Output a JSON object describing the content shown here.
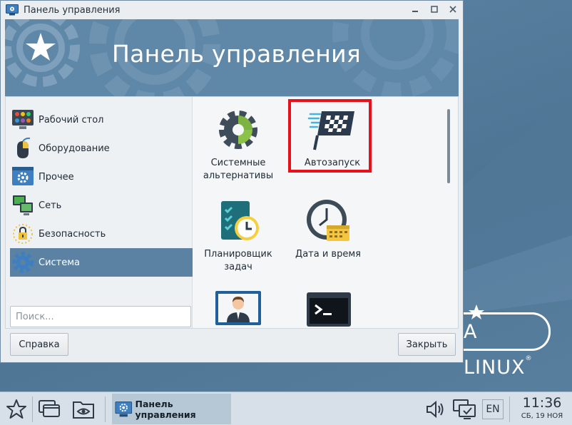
{
  "window": {
    "title": "Панель управления",
    "heading": "Панель управления"
  },
  "sidebar": {
    "items": [
      {
        "label": "Рабочий стол",
        "icon": "desktop-icon"
      },
      {
        "label": "Оборудование",
        "icon": "hardware-icon"
      },
      {
        "label": "Прочее",
        "icon": "other-icon"
      },
      {
        "label": "Сеть",
        "icon": "network-icon"
      },
      {
        "label": "Безопасность",
        "icon": "security-icon"
      },
      {
        "label": "Система",
        "icon": "system-icon",
        "active": true
      }
    ]
  },
  "tiles": [
    {
      "label_line1": "Системные",
      "label_line2": "альтернативы",
      "icon": "gear-icon"
    },
    {
      "label_line1": "Автозапуск",
      "label_line2": "",
      "icon": "checkered-flag-icon",
      "highlighted": true
    },
    {
      "label_line1": "Планировщик",
      "label_line2": "задач",
      "icon": "task-scheduler-icon"
    },
    {
      "label_line1": "Дата и время",
      "label_line2": "",
      "icon": "clock-calendar-icon"
    },
    {
      "label_line1": "",
      "label_line2": "",
      "icon": "user-monitor-icon"
    },
    {
      "label_line1": "",
      "label_line2": "",
      "icon": "terminal-icon"
    }
  ],
  "search": {
    "placeholder": "Поиск..."
  },
  "buttons": {
    "help": "Справка",
    "close": "Закрыть"
  },
  "desktop": {
    "logo_text": "A LINUX",
    "logo_mark": "®"
  },
  "taskbar": {
    "task_label": "Панель управления",
    "language": "EN",
    "time": "11:36",
    "date": "СБ, 19 НОЯ"
  },
  "colors": {
    "accent": "#5b82a3",
    "banner": "#5f87a7",
    "highlight": "#e8101a",
    "desktop": "#5a80a0"
  }
}
